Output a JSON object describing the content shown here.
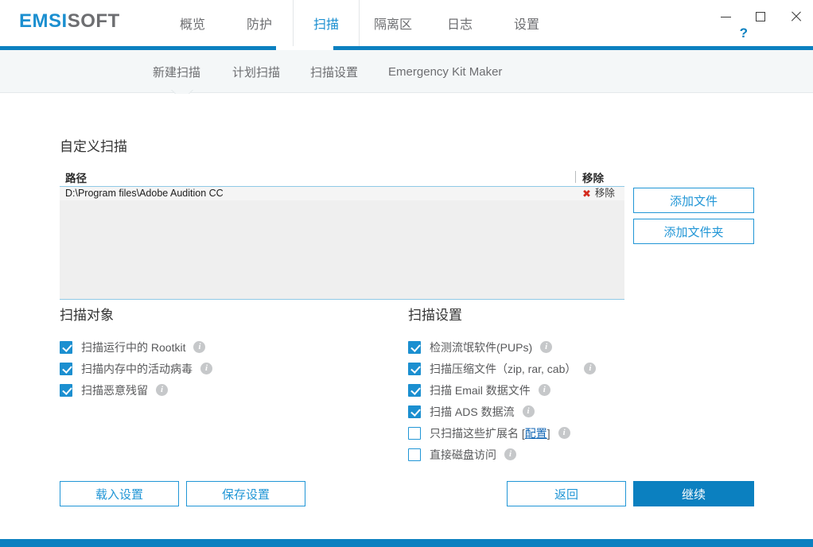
{
  "app": {
    "brand_primary": "EMSI",
    "brand_secondary": "SOFT",
    "accent_color": "#0b80c0",
    "link_color": "#1166b5"
  },
  "titlebar": {
    "minimize_label": "—",
    "maximize_label": "□",
    "close_label": "✕",
    "help_label": "?"
  },
  "mainnav": {
    "tabs": [
      {
        "label": "概览",
        "active": false
      },
      {
        "label": "防护",
        "active": false
      },
      {
        "label": "扫描",
        "active": true
      },
      {
        "label": "隔离区",
        "active": false
      },
      {
        "label": "日志",
        "active": false
      },
      {
        "label": "设置",
        "active": false
      }
    ]
  },
  "subnav": {
    "items": [
      {
        "label": "新建扫描",
        "active": true
      },
      {
        "label": "计划扫描",
        "active": false
      },
      {
        "label": "扫描设置",
        "active": false
      },
      {
        "label": "Emergency Kit Maker",
        "active": false
      }
    ]
  },
  "main": {
    "custom_scan_title": "自定义扫描",
    "table": {
      "headers": {
        "path": "路径",
        "remove": "移除"
      },
      "rows": [
        {
          "path": "D:\\Program files\\Adobe Audition CC",
          "remove_label": "移除",
          "remove_icon": "✖"
        }
      ]
    },
    "add_file_label": "添加文件",
    "add_folder_label": "添加文件夹",
    "scan_objects": {
      "title": "扫描对象",
      "items": [
        {
          "label": "扫描运行中的 Rootkit",
          "checked": true,
          "info": "i"
        },
        {
          "label": "扫描内存中的活动病毒",
          "checked": true,
          "info": "i"
        },
        {
          "label": "扫描恶意残留",
          "checked": true,
          "info": "i"
        }
      ]
    },
    "scan_settings": {
      "title": "扫描设置",
      "items": [
        {
          "label": "检测流氓软件(PUPs)",
          "checked": true,
          "info": "i"
        },
        {
          "label": "扫描压缩文件（zip, rar, cab）",
          "checked": true,
          "info": "i"
        },
        {
          "label": "扫描 Email 数据文件",
          "checked": true,
          "info": "i"
        },
        {
          "label": "扫描 ADS 数据流",
          "checked": true,
          "info": "i"
        },
        {
          "label_prefix": "只扫描这些扩展名 [",
          "link": "配置",
          "label_suffix": "]",
          "checked": false,
          "info": "i"
        },
        {
          "label": "直接磁盘访问",
          "checked": false,
          "info": "i"
        }
      ]
    },
    "load_settings_label": "载入设置",
    "save_settings_label": "保存设置",
    "back_label": "返回",
    "continue_label": "继续"
  }
}
